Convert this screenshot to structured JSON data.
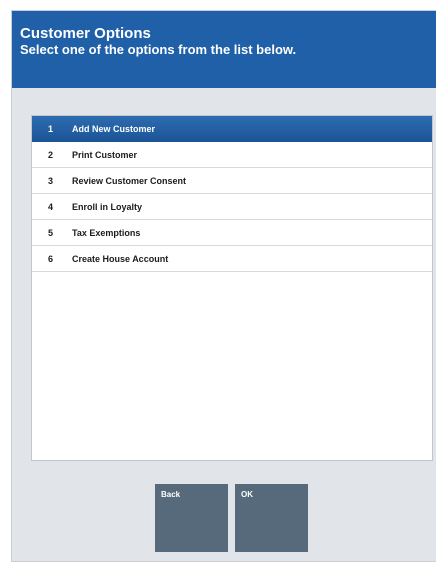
{
  "header": {
    "title": "Customer Options",
    "subtitle": "Select one of the options from the list below."
  },
  "options": [
    {
      "number": "1",
      "label": "Add New Customer",
      "selected": true
    },
    {
      "number": "2",
      "label": "Print Customer",
      "selected": false
    },
    {
      "number": "3",
      "label": "Review Customer Consent",
      "selected": false
    },
    {
      "number": "4",
      "label": "Enroll in Loyalty",
      "selected": false
    },
    {
      "number": "5",
      "label": "Tax Exemptions",
      "selected": false
    },
    {
      "number": "6",
      "label": "Create House Account",
      "selected": false
    }
  ],
  "buttons": {
    "back_label": "Back",
    "ok_label": "OK"
  },
  "colors": {
    "header_bg": "#1f60a8",
    "selected_row": "#2d6cb0",
    "button_bg": "#566a7b",
    "panel_bg": "#e1e4e8"
  }
}
